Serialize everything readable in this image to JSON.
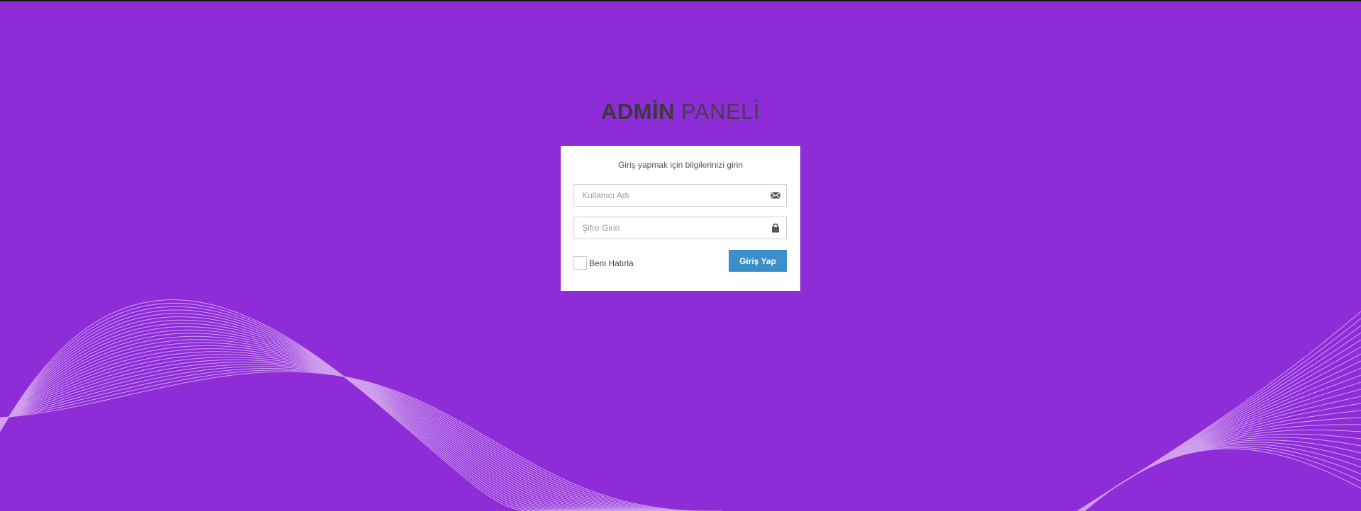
{
  "page": {
    "background_color": "#8e2cd8",
    "title_bold": "ADMİN",
    "title_light": "PANELİ"
  },
  "login": {
    "subtitle": "Giriş yapmak için bilgilerinizi girin",
    "username": {
      "placeholder": "Kullanıcı Adı",
      "value": "",
      "icon": "envelope-icon"
    },
    "password": {
      "placeholder": "Şifre Girin",
      "value": "",
      "icon": "lock-icon"
    },
    "remember_label": "Beni Hatırla",
    "remember_checked": false,
    "submit_label": "Giriş Yap",
    "submit_color": "#3a8ec9"
  }
}
